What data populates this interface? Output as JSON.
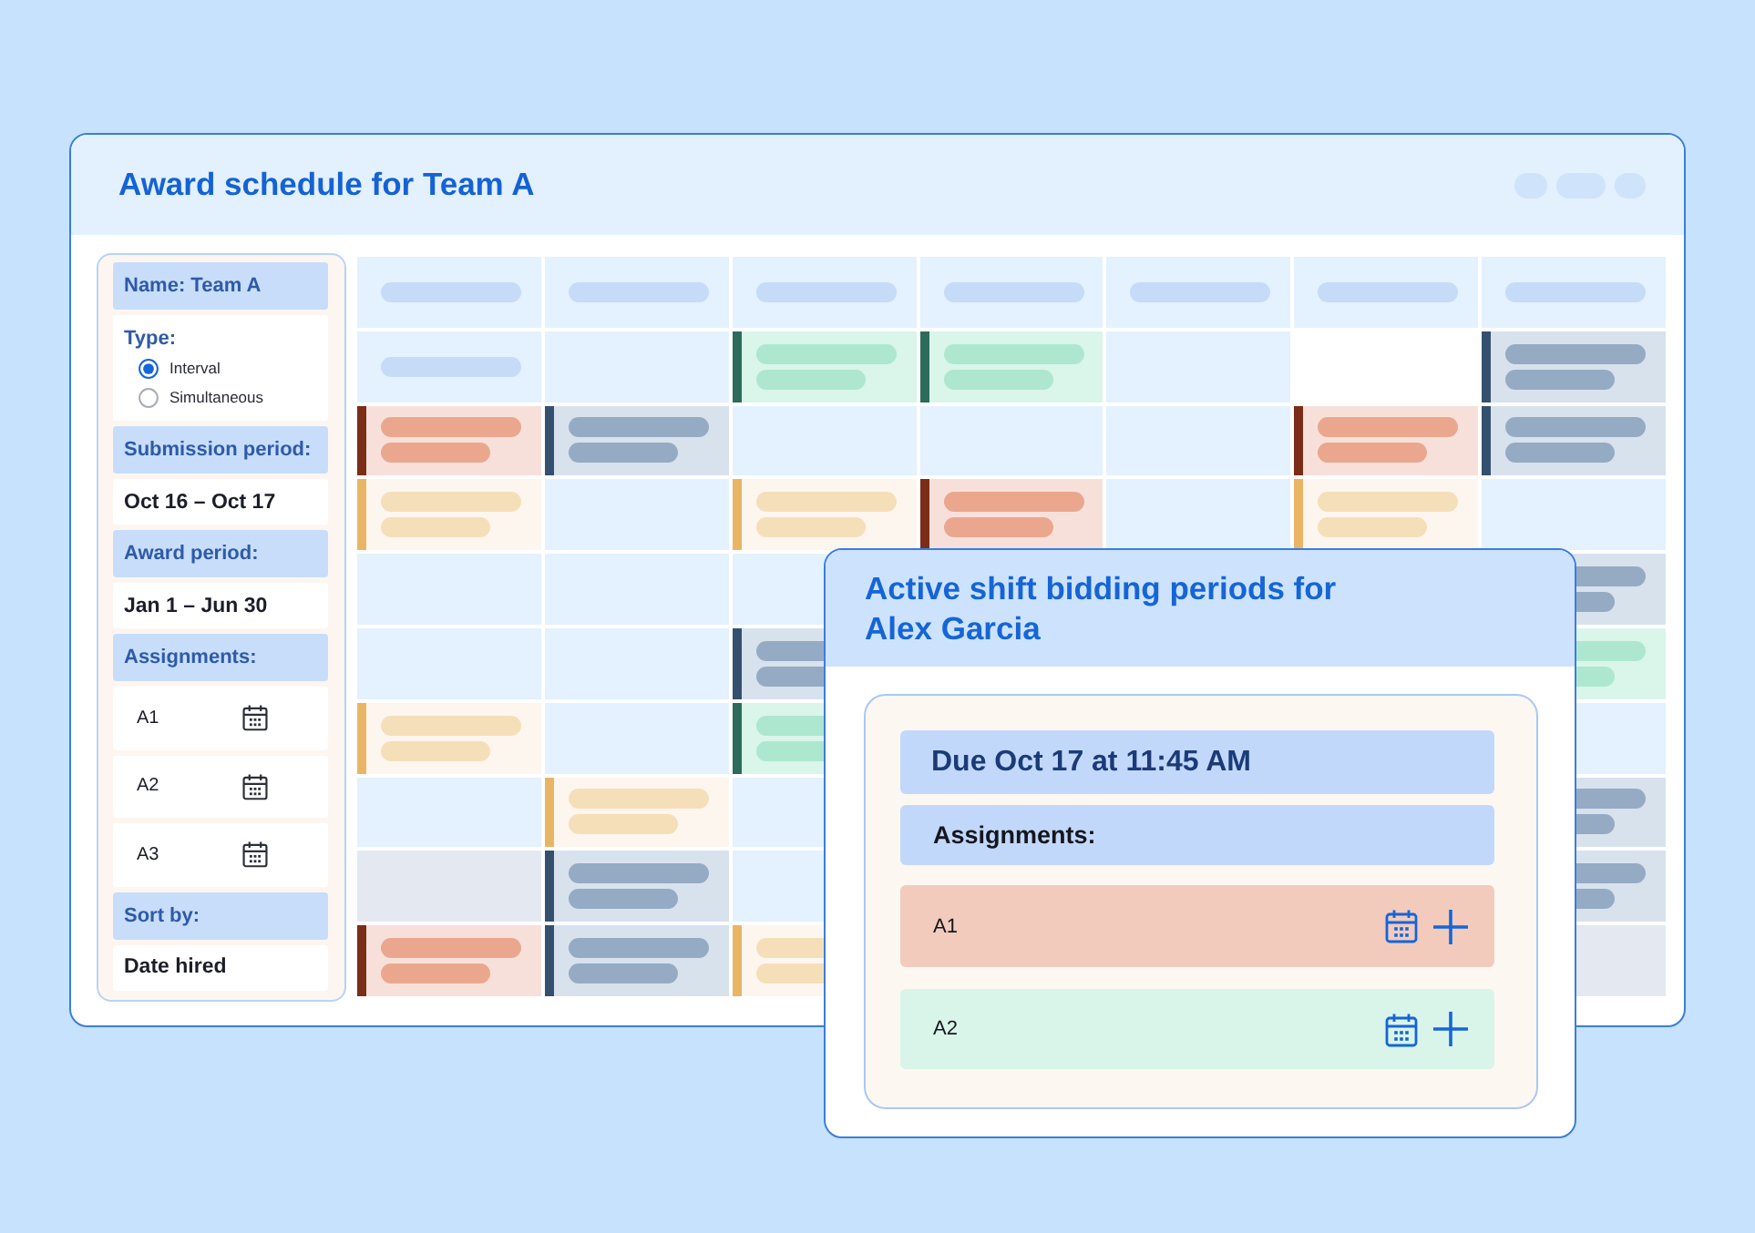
{
  "window": {
    "title": "Award schedule for Team A"
  },
  "settings_panel": {
    "blocks": [
      {
        "kind": "heading",
        "text": "Name: Team A"
      },
      {
        "kind": "radio_group",
        "label": "Type:",
        "options": [
          {
            "label": "Interval",
            "selected": true
          },
          {
            "label": "Simultaneous",
            "selected": false
          }
        ]
      },
      {
        "kind": "heading",
        "text": "Submission period:"
      },
      {
        "kind": "value",
        "text": "Oct 16 – Oct 17"
      },
      {
        "kind": "heading",
        "text": "Award period:"
      },
      {
        "kind": "value",
        "text": "Jan 1 – Jun 30"
      },
      {
        "kind": "heading",
        "text": "Assignments:"
      },
      {
        "kind": "assignment",
        "text": "A1"
      },
      {
        "kind": "assignment",
        "text": "A2"
      },
      {
        "kind": "assignment",
        "text": "A3"
      },
      {
        "kind": "heading",
        "text": "Sort by:"
      },
      {
        "kind": "value",
        "text": "Date hired"
      }
    ]
  },
  "schedule": {
    "rows": [
      {
        "cells": [
          {
            "kind": "header"
          },
          {
            "kind": "header"
          },
          {
            "kind": "header"
          },
          {
            "kind": "header"
          },
          {
            "kind": "header"
          },
          {
            "kind": "header"
          },
          {
            "kind": "header"
          }
        ]
      },
      {
        "cells": [
          {
            "kind": "label"
          },
          {
            "kind": "empty"
          },
          {
            "kind": "shift",
            "color": "#ade7d0"
          },
          {
            "kind": "shift",
            "color": "#ade7d0"
          },
          {
            "kind": "empty"
          },
          {
            "kind": "blank"
          },
          {
            "kind": "shift",
            "color": "#95abc4"
          }
        ]
      },
      {
        "cells": [
          {
            "kind": "shift",
            "color": "#eaa78e"
          },
          {
            "kind": "shift",
            "color": "#95abc4"
          },
          {
            "kind": "empty"
          },
          {
            "kind": "empty"
          },
          {
            "kind": "empty"
          },
          {
            "kind": "shift",
            "color": "#eaa78e"
          },
          {
            "kind": "shift",
            "color": "#95abc4"
          }
        ]
      },
      {
        "cells": [
          {
            "kind": "shift",
            "color": "#f5dfb9"
          },
          {
            "kind": "empty"
          },
          {
            "kind": "shift",
            "color": "#f5dfb9"
          },
          {
            "kind": "shift",
            "color": "#eaa78e"
          },
          {
            "kind": "empty"
          },
          {
            "kind": "shift",
            "color": "#f5dfb9"
          },
          {
            "kind": "empty"
          }
        ]
      },
      {
        "cells": [
          {
            "kind": "empty"
          },
          {
            "kind": "empty"
          },
          {
            "kind": "empty"
          },
          {
            "kind": "covered"
          },
          {
            "kind": "covered"
          },
          {
            "kind": "covered"
          },
          {
            "kind": "shift",
            "color": "#95abc4"
          }
        ]
      },
      {
        "cells": [
          {
            "kind": "empty"
          },
          {
            "kind": "empty"
          },
          {
            "kind": "shift",
            "color": "#95abc4"
          },
          {
            "kind": "covered"
          },
          {
            "kind": "covered"
          },
          {
            "kind": "covered"
          },
          {
            "kind": "shift",
            "color": "#ade7d0"
          }
        ]
      },
      {
        "cells": [
          {
            "kind": "shift",
            "color": "#f5dfb9"
          },
          {
            "kind": "empty"
          },
          {
            "kind": "shift",
            "color": "#ade7d0"
          },
          {
            "kind": "covered"
          },
          {
            "kind": "covered"
          },
          {
            "kind": "covered"
          },
          {
            "kind": "empty"
          }
        ]
      },
      {
        "cells": [
          {
            "kind": "empty"
          },
          {
            "kind": "shift",
            "color": "#f5dfb9"
          },
          {
            "kind": "empty"
          },
          {
            "kind": "covered"
          },
          {
            "kind": "covered"
          },
          {
            "kind": "covered"
          },
          {
            "kind": "shift",
            "color": "#95abc4"
          }
        ]
      },
      {
        "cells": [
          {
            "kind": "muted"
          },
          {
            "kind": "shift",
            "color": "#95abc4"
          },
          {
            "kind": "empty"
          },
          {
            "kind": "covered"
          },
          {
            "kind": "covered"
          },
          {
            "kind": "covered"
          },
          {
            "kind": "shift",
            "color": "#95abc4"
          }
        ]
      },
      {
        "cells": [
          {
            "kind": "shift",
            "color": "#eaa78e"
          },
          {
            "kind": "shift",
            "color": "#95abc4"
          },
          {
            "kind": "shift",
            "color": "#f5dfb9"
          },
          {
            "kind": "covered"
          },
          {
            "kind": "covered"
          },
          {
            "kind": "covered"
          },
          {
            "kind": "muted"
          }
        ]
      }
    ]
  },
  "popup": {
    "title": "Active shift bidding periods for Alex Garcia",
    "due": "Due Oct 17 at 11:45 AM",
    "assignments_label": "Assignments:",
    "assignments": [
      {
        "label": "A1",
        "color": "#f2cbbd"
      },
      {
        "label": "A2",
        "color": "#d9f4e9"
      }
    ]
  }
}
